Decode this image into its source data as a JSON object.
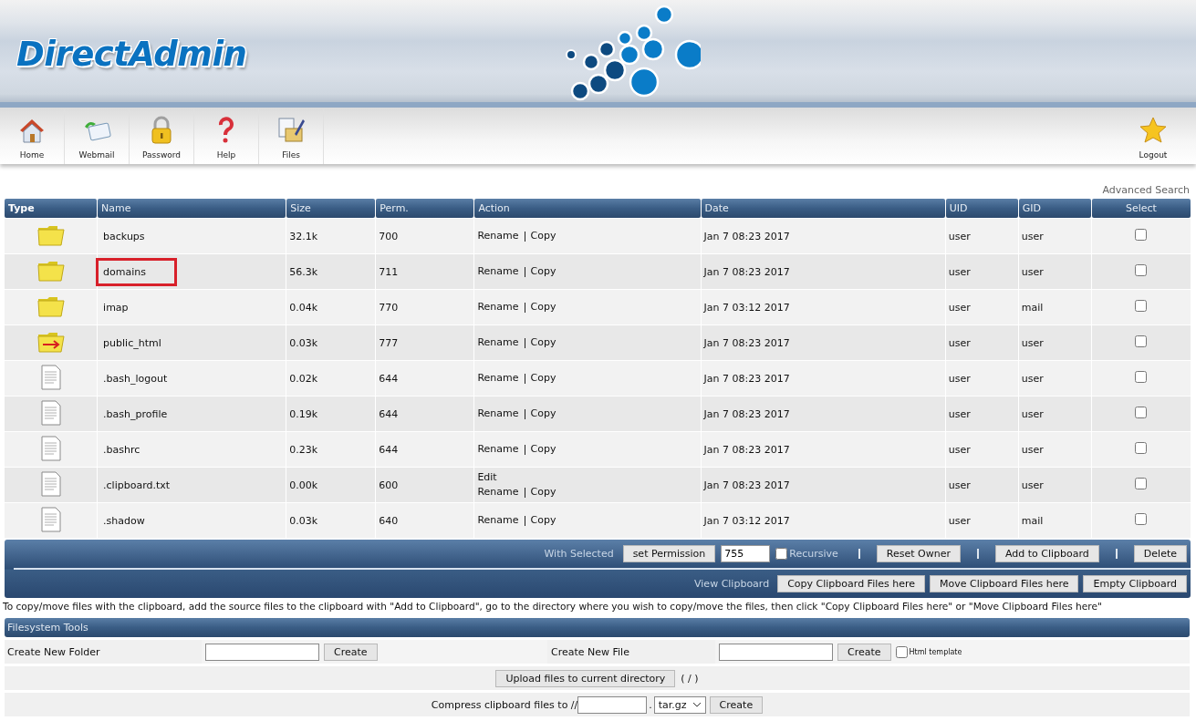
{
  "header": {
    "logo": "DirectAdmin"
  },
  "toolbar": [
    {
      "label": "Home",
      "kind": "home"
    },
    {
      "label": "Webmail",
      "kind": "mail"
    },
    {
      "label": "Password",
      "kind": "lock"
    },
    {
      "label": "Help",
      "kind": "help"
    },
    {
      "label": "Files",
      "kind": "files"
    }
  ],
  "logout": {
    "label": "Logout",
    "kind": "star"
  },
  "advanced_search": "Advanced Search",
  "table": {
    "columns": [
      "Type",
      "Name",
      "Size",
      "Perm.",
      "Action",
      "Date",
      "UID",
      "GID",
      "Select"
    ],
    "rows": [
      {
        "kind": "folder",
        "name": "backups",
        "highlighted": false,
        "size": "32.1k",
        "perm": "700",
        "actions": [
          [
            "Rename",
            "Copy"
          ]
        ],
        "date": "Jan 7 08:23 2017",
        "uid": "user",
        "gid": "user",
        "selected": false
      },
      {
        "kind": "folder",
        "name": "domains",
        "highlighted": true,
        "size": "56.3k",
        "perm": "711",
        "actions": [
          [
            "Rename",
            "Copy"
          ]
        ],
        "date": "Jan 7 08:23 2017",
        "uid": "user",
        "gid": "user",
        "selected": false
      },
      {
        "kind": "folder",
        "name": "imap",
        "highlighted": false,
        "size": "0.04k",
        "perm": "770",
        "actions": [
          [
            "Rename",
            "Copy"
          ]
        ],
        "date": "Jan 7 03:12 2017",
        "uid": "user",
        "gid": "mail",
        "selected": false
      },
      {
        "kind": "link-folder",
        "name": "public_html",
        "highlighted": false,
        "size": "0.03k",
        "perm": "777",
        "actions": [
          [
            "Rename",
            "Copy"
          ]
        ],
        "date": "Jan 7 08:23 2017",
        "uid": "user",
        "gid": "user",
        "selected": false
      },
      {
        "kind": "file",
        "name": ".bash_logout",
        "highlighted": false,
        "size": "0.02k",
        "perm": "644",
        "actions": [
          [
            "Rename",
            "Copy"
          ]
        ],
        "date": "Jan 7 08:23 2017",
        "uid": "user",
        "gid": "user",
        "selected": false
      },
      {
        "kind": "file",
        "name": ".bash_profile",
        "highlighted": false,
        "size": "0.19k",
        "perm": "644",
        "actions": [
          [
            "Rename",
            "Copy"
          ]
        ],
        "date": "Jan 7 08:23 2017",
        "uid": "user",
        "gid": "user",
        "selected": false
      },
      {
        "kind": "file",
        "name": ".bashrc",
        "highlighted": false,
        "size": "0.23k",
        "perm": "644",
        "actions": [
          [
            "Rename",
            "Copy"
          ]
        ],
        "date": "Jan 7 08:23 2017",
        "uid": "user",
        "gid": "user",
        "selected": false
      },
      {
        "kind": "file",
        "name": ".clipboard.txt",
        "highlighted": false,
        "size": "0.00k",
        "perm": "600",
        "actions": [
          [
            "Edit"
          ],
          [
            "Rename",
            "Copy"
          ]
        ],
        "date": "Jan 7 08:23 2017",
        "uid": "user",
        "gid": "user",
        "selected": false
      },
      {
        "kind": "file",
        "name": ".shadow",
        "highlighted": false,
        "size": "0.03k",
        "perm": "640",
        "actions": [
          [
            "Rename",
            "Copy"
          ]
        ],
        "date": "Jan 7 03:12 2017",
        "uid": "user",
        "gid": "mail",
        "selected": false
      }
    ]
  },
  "with_selected": {
    "label": "With Selected",
    "set_permission": "set Permission",
    "permission_value": "755",
    "recursive": {
      "label": "Recursive",
      "checked": false
    },
    "buttons": [
      "Reset Owner",
      "Add to Clipboard",
      "Delete"
    ]
  },
  "clipboard": {
    "label": "View Clipboard",
    "buttons": [
      "Copy Clipboard Files here",
      "Move Clipboard Files here",
      "Empty Clipboard"
    ]
  },
  "note": "To copy/move files with the clipboard, add the source files to the clipboard with \"Add to Clipboard\", go to the directory where you wish to copy/move the files, then click \"Copy Clipboard Files here\" or \"Move Clipboard Files here\"",
  "filesystem_tools": {
    "title": "Filesystem Tools",
    "create_folder": {
      "label": "Create New Folder",
      "button": "Create"
    },
    "create_file": {
      "label": "Create New File",
      "button": "Create",
      "html_template": {
        "label": "Html template",
        "checked": false
      }
    },
    "upload": {
      "button": "Upload files to current directory",
      "path": "( / )"
    },
    "compress": {
      "label": "Compress clipboard files to //",
      "separator": ".",
      "format": "tar.gz",
      "button": "Create"
    }
  }
}
